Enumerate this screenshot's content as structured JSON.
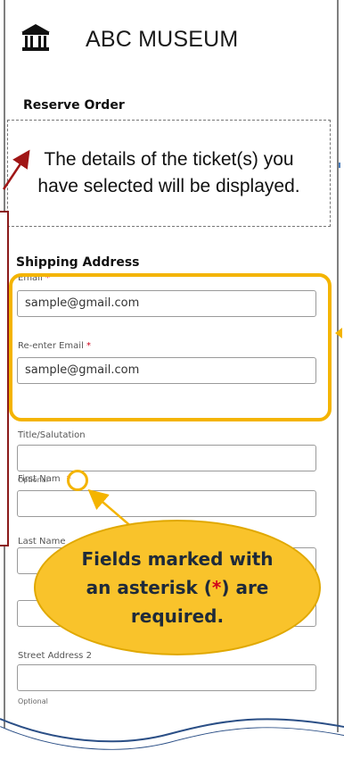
{
  "header": {
    "title": "ABC MUSEUM",
    "logo_icon": "museum-icon"
  },
  "reserve_order": {
    "heading": "Reserve Order",
    "details_text": "The details of the ticket(s) you have selected will be displayed."
  },
  "shipping": {
    "heading": "Shipping Address",
    "required_mark": "*",
    "email": {
      "label": "Email",
      "value": "sample@gmail.com"
    },
    "reenter_email": {
      "label": "Re-enter Email",
      "value": "sample@gmail.com"
    },
    "title_salutation": {
      "label": "Title/Salutation",
      "value": "",
      "hint": "Optional"
    },
    "first_name": {
      "label": "First Nam",
      "value": ""
    },
    "last_name": {
      "label": "Last Name",
      "value": ""
    },
    "street_address_1": {
      "value": ""
    },
    "street_address_2": {
      "label": "Street Address 2",
      "value": "",
      "hint": "Optional"
    }
  },
  "annotation": {
    "callout_before": "Fields marked with an asterisk (",
    "callout_asterisk": "*",
    "callout_after": ") are required."
  },
  "colors": {
    "highlight": "#f4b400",
    "callout_fill": "#f9c32b",
    "required": "#d0021b",
    "left_panel": "#8b1a1a"
  }
}
